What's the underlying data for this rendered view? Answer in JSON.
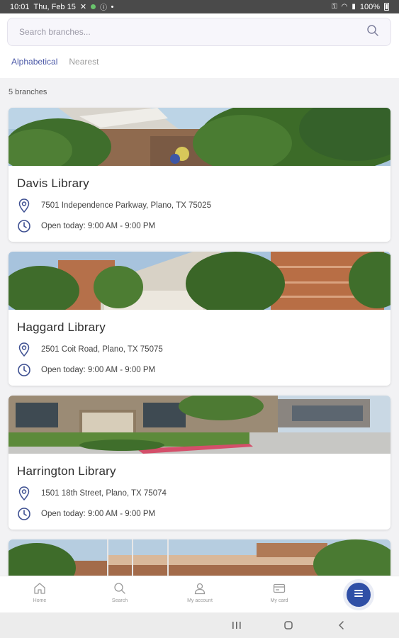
{
  "status_bar": {
    "time": "10:01",
    "date": "Thu, Feb 15",
    "battery": "100%"
  },
  "search": {
    "placeholder": "Search branches..."
  },
  "tabs": [
    {
      "label": "Alphabetical",
      "active": true
    },
    {
      "label": "Nearest",
      "active": false
    }
  ],
  "branch_count": "5 branches",
  "branches": [
    {
      "name": "Davis Library",
      "address": "7501 Independence Parkway, Plano, TX 75025",
      "hours": "Open today: 9:00 AM - 9:00 PM"
    },
    {
      "name": "Haggard Library",
      "address": "2501 Coit Road, Plano, TX 75075",
      "hours": "Open today: 9:00 AM - 9:00 PM"
    },
    {
      "name": "Harrington Library",
      "address": "1501 18th Street, Plano, TX 75074",
      "hours": "Open today: 9:00 AM - 9:00 PM"
    }
  ],
  "bottom_nav": {
    "home": "Home",
    "search": "Search",
    "account": "My account",
    "card": "My card"
  },
  "colors": {
    "accent": "#4d5aa8",
    "fab": "#2f4fa6",
    "icon": "#3d4f91"
  }
}
